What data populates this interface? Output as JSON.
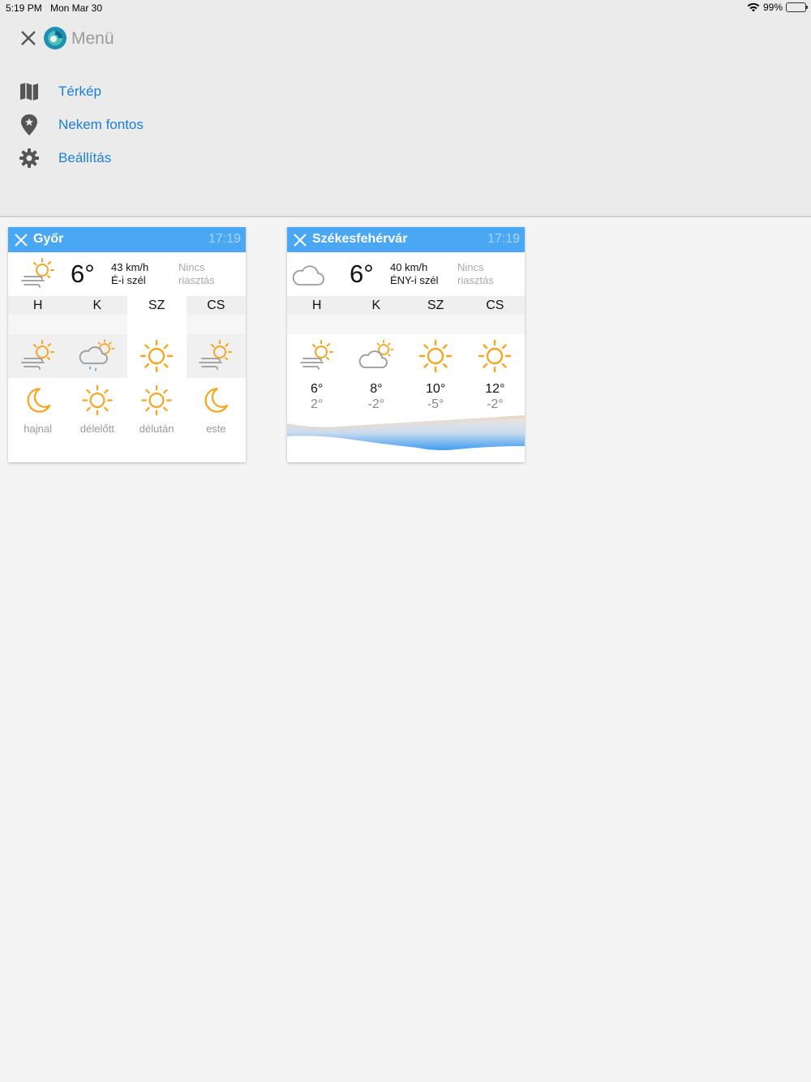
{
  "status": {
    "time": "5:19 PM",
    "date": "Mon Mar 30",
    "battery": "99%"
  },
  "menu": {
    "title": "Menü",
    "items": [
      {
        "label": "Térkép",
        "icon": "map-icon"
      },
      {
        "label": "Nekem fontos",
        "icon": "pin-star-icon"
      },
      {
        "label": "Beállítás",
        "icon": "gear-icon"
      }
    ]
  },
  "cards": [
    {
      "city": "Győr",
      "time": "17:19",
      "temp": "6°",
      "wind_speed": "43 km/h",
      "wind_dir": "É-i szél",
      "alert_line1": "Nincs",
      "alert_line2": "riasztás",
      "days": [
        "H",
        "K",
        "SZ",
        "CS"
      ],
      "day_icons": [
        "windy-sun-icon",
        "rain-sun-icon",
        "sun-icon",
        "windy-sun-icon"
      ],
      "period_icons": [
        "moon-icon",
        "sun-icon",
        "sun-icon",
        "moon-icon"
      ],
      "periods": [
        "hajnal",
        "délelőtt",
        "délután",
        "este"
      ]
    },
    {
      "city": "Székesfehérvár",
      "time": "17:19",
      "temp": "6°",
      "wind_speed": "40 km/h",
      "wind_dir": "ÉNY-i szél",
      "alert_line1": "Nincs",
      "alert_line2": "riasztás",
      "days": [
        "H",
        "K",
        "SZ",
        "CS"
      ],
      "day_icons": [
        "windy-sun-icon",
        "cloud-sun-icon",
        "sun-icon",
        "sun-icon"
      ],
      "highs": [
        "6°",
        "8°",
        "10°",
        "12°"
      ],
      "lows": [
        "2°",
        "-2°",
        "-5°",
        "-2°"
      ]
    }
  ],
  "colors": {
    "accent": "#4aa7f4",
    "link": "#1a7fd6",
    "sun": "#f5a623"
  }
}
